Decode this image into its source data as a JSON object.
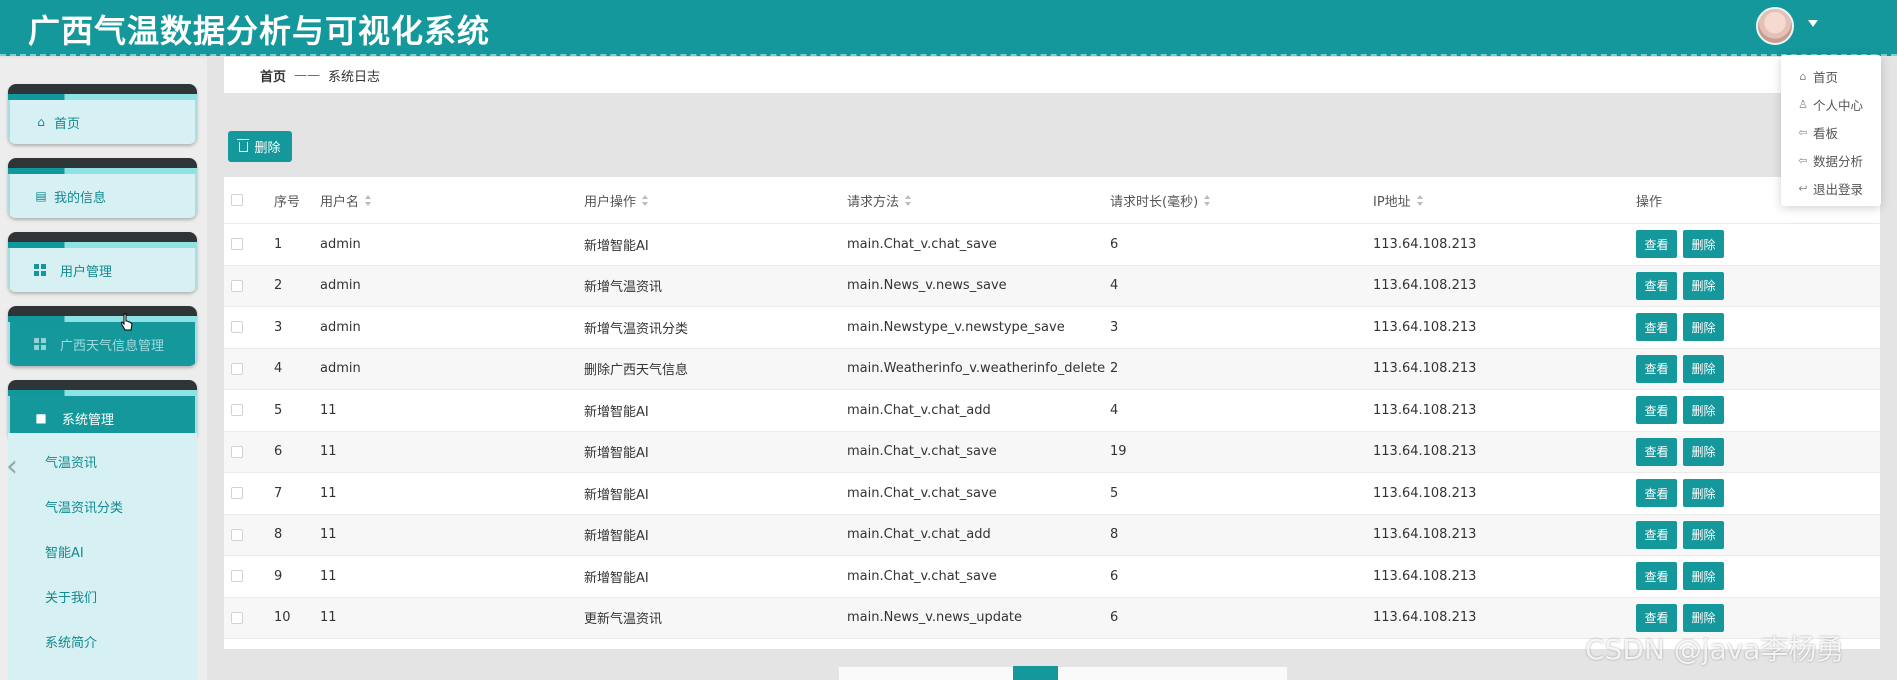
{
  "header": {
    "title": "广西气温数据分析与可视化系统",
    "accent_color": "#14989c"
  },
  "sidebar": {
    "menu": [
      {
        "label": "首页",
        "icon": "home-icon"
      },
      {
        "label": "我的信息",
        "icon": "id-card-icon"
      },
      {
        "label": "用户管理",
        "icon": "grid-icon"
      },
      {
        "label": "广西天气信息管理",
        "icon": "grid-icon"
      },
      {
        "label": "系统管理",
        "icon": "briefcase-icon"
      }
    ],
    "submenu": [
      "气温资讯",
      "气温资讯分类",
      "智能AI",
      "关于我们",
      "系统简介"
    ]
  },
  "breadcrumb": {
    "home": "首页",
    "separator": "——",
    "current": "系统日志"
  },
  "toolbar": {
    "delete_label": "删除"
  },
  "table": {
    "columns": [
      "序号",
      "用户名",
      "用户操作",
      "请求方法",
      "请求时长(毫秒)",
      "IP地址",
      "操作"
    ],
    "rows": [
      {
        "index": "1",
        "user": "admin",
        "op": "新增智能AI",
        "method": "main.Chat_v.chat_save",
        "duration": "6",
        "ip": "113.64.108.213"
      },
      {
        "index": "2",
        "user": "admin",
        "op": "新增气温资讯",
        "method": "main.News_v.news_save",
        "duration": "4",
        "ip": "113.64.108.213"
      },
      {
        "index": "3",
        "user": "admin",
        "op": "新增气温资讯分类",
        "method": "main.Newstype_v.newstype_save",
        "duration": "3",
        "ip": "113.64.108.213"
      },
      {
        "index": "4",
        "user": "admin",
        "op": "删除广西天气信息",
        "method": "main.Weatherinfo_v.weatherinfo_delete",
        "duration": "2",
        "ip": "113.64.108.213"
      },
      {
        "index": "5",
        "user": "11",
        "op": "新增智能AI",
        "method": "main.Chat_v.chat_add",
        "duration": "4",
        "ip": "113.64.108.213"
      },
      {
        "index": "6",
        "user": "11",
        "op": "新增智能AI",
        "method": "main.Chat_v.chat_save",
        "duration": "19",
        "ip": "113.64.108.213"
      },
      {
        "index": "7",
        "user": "11",
        "op": "新增智能AI",
        "method": "main.Chat_v.chat_save",
        "duration": "5",
        "ip": "113.64.108.213"
      },
      {
        "index": "8",
        "user": "11",
        "op": "新增智能AI",
        "method": "main.Chat_v.chat_add",
        "duration": "8",
        "ip": "113.64.108.213"
      },
      {
        "index": "9",
        "user": "11",
        "op": "新增智能AI",
        "method": "main.Chat_v.chat_save",
        "duration": "6",
        "ip": "113.64.108.213"
      },
      {
        "index": "10",
        "user": "11",
        "op": "更新气温资讯",
        "method": "main.News_v.news_update",
        "duration": "6",
        "ip": "113.64.108.213"
      }
    ],
    "view_label": "查看",
    "delete_label": "删除"
  },
  "user_menu": {
    "items": [
      {
        "label": "首页",
        "icon": "home-icon"
      },
      {
        "label": "个人中心",
        "icon": "user-icon"
      },
      {
        "label": "看板",
        "icon": "arrow-left-icon"
      },
      {
        "label": "数据分析",
        "icon": "arrow-left-icon"
      },
      {
        "label": "退出登录",
        "icon": "logout-icon"
      }
    ]
  },
  "watermark": "CSDN @java李杨勇"
}
